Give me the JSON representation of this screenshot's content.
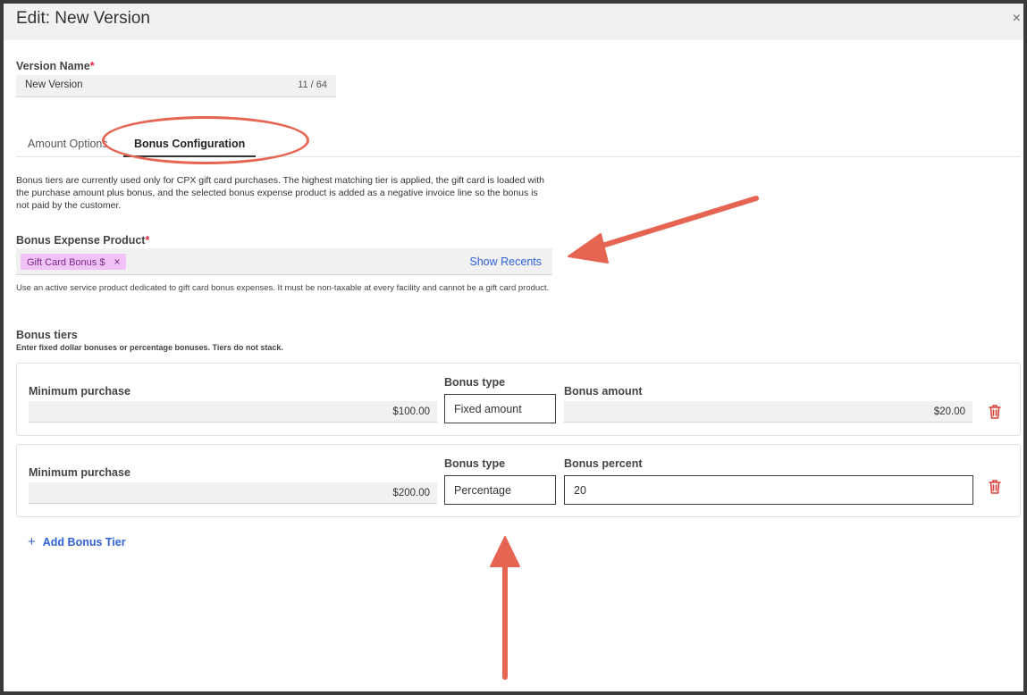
{
  "modal": {
    "title": "Edit: New Version",
    "close_symbol": "×"
  },
  "version_name": {
    "label": "Version Name",
    "required_mark": "*",
    "value": "New Version",
    "counter": "11 / 64"
  },
  "tabs": [
    {
      "label": "Amount Options",
      "active": false
    },
    {
      "label": "Bonus Configuration",
      "active": true
    }
  ],
  "description": "Bonus tiers are currently used only for CPX gift card purchases. The highest matching tier is applied, the gift card is loaded with the purchase amount plus bonus, and the selected bonus expense product is added as a negative invoice line so the bonus is not paid by the customer.",
  "bonus_expense_product": {
    "label": "Bonus Expense Product",
    "required_mark": "*",
    "chip": "Gift Card Bonus $",
    "chip_remove": "×",
    "show_recents": "Show Recents",
    "help": "Use an active service product dedicated to gift card bonus expenses. It must be non-taxable at every facility and cannot be a gift card product."
  },
  "bonus_tiers": {
    "title": "Bonus tiers",
    "subtitle": "Enter fixed dollar bonuses or percentage bonuses. Tiers do not stack.",
    "items": [
      {
        "min_label": "Minimum purchase",
        "min_value": "$100.00",
        "type_label": "Bonus type",
        "type_value": "Fixed amount",
        "amount_label": "Bonus amount",
        "amount_value": "$20.00"
      },
      {
        "min_label": "Minimum purchase",
        "min_value": "$200.00",
        "type_label": "Bonus type",
        "type_value": "Percentage",
        "amount_label": "Bonus percent",
        "amount_value": "20"
      }
    ],
    "add_symbol": "+",
    "add_label": "Add Bonus Tier"
  },
  "colors": {
    "annotation": "#e66552",
    "link": "#2f62d6",
    "required": "#e0293b",
    "chip_bg": "#f0c2f5",
    "trash": "#d9433a"
  },
  "icons": {
    "close": "close-icon",
    "trash": "trash-icon",
    "add": "plus-icon",
    "chip_remove": "close-icon"
  }
}
